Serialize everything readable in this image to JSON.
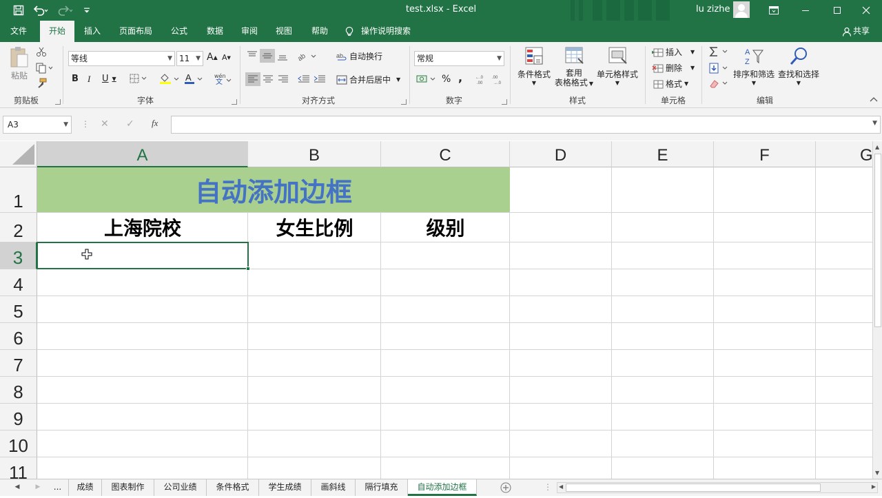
{
  "titlebar": {
    "file_title": "test.xlsx  -  Excel",
    "user": "lu zizhe",
    "save_icon": "save-icon",
    "undo_icon": "undo-icon",
    "redo_icon": "redo-icon"
  },
  "menu": {
    "items": [
      "文件",
      "开始",
      "插入",
      "页面布局",
      "公式",
      "数据",
      "审阅",
      "视图",
      "帮助"
    ],
    "active": "开始",
    "tell_me": "操作说明搜索",
    "share": "共享"
  },
  "ribbon": {
    "clipboard": {
      "paste": "粘贴",
      "label": "剪贴板"
    },
    "font": {
      "name": "等线",
      "size": "11",
      "label": "字体",
      "bold": "B",
      "italic": "I",
      "underline": "U",
      "grow": "A",
      "shrink": "A",
      "font_color": "A"
    },
    "alignment": {
      "wrap": "自动换行",
      "merge": "合并后居中",
      "label": "对齐方式"
    },
    "number": {
      "format": "常规",
      "percent": "%",
      "comma": ",",
      "label": "数字"
    },
    "styles": {
      "conditional": "条件格式",
      "table_line1": "套用",
      "table_line2": "表格格式",
      "cell_styles": "单元格样式",
      "label": "样式"
    },
    "cells": {
      "insert": "插入",
      "delete": "删除",
      "format": "格式",
      "label": "单元格"
    },
    "editing": {
      "sort": "排序和筛选",
      "find": "查找和选择",
      "label": "编辑"
    }
  },
  "formula_bar": {
    "name_box": "A3",
    "cancel": "✕",
    "enter": "✓",
    "fx": "fx",
    "content": ""
  },
  "sheet": {
    "columns": [
      "A",
      "B",
      "C",
      "D",
      "E",
      "F",
      "G"
    ],
    "rows": [
      "1",
      "2",
      "3",
      "4",
      "5",
      "6",
      "7",
      "8",
      "9",
      "10",
      "11"
    ],
    "selected_cell": "A3",
    "title_cell": "自动添加边框",
    "headers": [
      "上海院校",
      "女生比例",
      "级别"
    ],
    "colors": {
      "title_fill": "#a9d08e",
      "title_text": "#4472c4",
      "accent": "#217346"
    }
  },
  "tabs": {
    "more": "...",
    "items": [
      "成绩",
      "图表制作",
      "公司业绩",
      "条件格式",
      "学生成绩",
      "画斜线",
      "隔行填充",
      "自动添加边框"
    ],
    "active": "自动添加边框"
  }
}
